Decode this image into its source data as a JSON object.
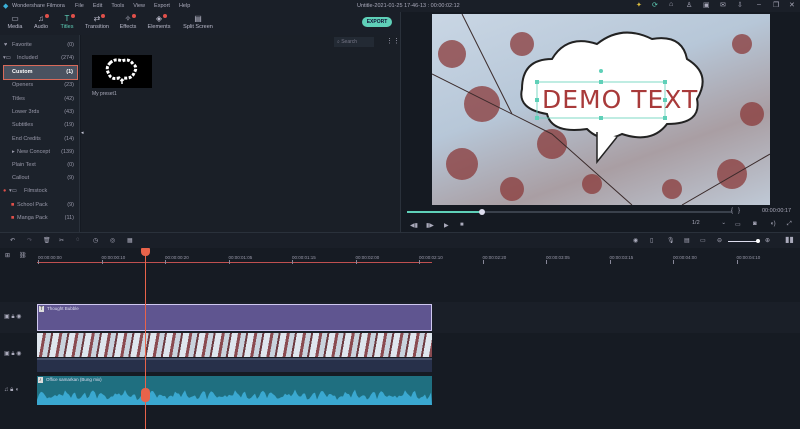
{
  "app": {
    "name": "Wondershare Filmora",
    "title": "Untitle-2021-01-25 17-46-13 : 00:00:02:12",
    "menu": [
      "File",
      "Edit",
      "Tools",
      "View",
      "Export",
      "Help"
    ]
  },
  "toolbar": {
    "tabs": [
      {
        "label": "Media"
      },
      {
        "label": "Audio"
      },
      {
        "label": "Titles"
      },
      {
        "label": "Transition"
      },
      {
        "label": "Effects"
      },
      {
        "label": "Elements"
      },
      {
        "label": "Split Screen"
      }
    ],
    "export_label": "EXPORT"
  },
  "sidebar": {
    "items": [
      {
        "label": "Favorite",
        "count": "(0)"
      },
      {
        "label": "Included",
        "count": "(274)"
      },
      {
        "label": "Custom",
        "count": "(1)"
      },
      {
        "label": "Openers",
        "count": "(23)"
      },
      {
        "label": "Titles",
        "count": "(42)"
      },
      {
        "label": "Lower 3rds",
        "count": "(43)"
      },
      {
        "label": "Subtitles",
        "count": "(19)"
      },
      {
        "label": "End Credits",
        "count": "(14)"
      },
      {
        "label": "New Concept",
        "count": "(139)"
      },
      {
        "label": "Plain Text",
        "count": "(0)"
      },
      {
        "label": "Callout",
        "count": "(9)"
      },
      {
        "label": "Filmstock",
        "count": ""
      },
      {
        "label": "School Pack",
        "count": "(9)"
      },
      {
        "label": "Manga Pack",
        "count": "(11)"
      }
    ]
  },
  "library": {
    "search_placeholder": "Search",
    "items": [
      {
        "label": "My preset1"
      }
    ]
  },
  "preview": {
    "overlay_text": "DEMO TEXT",
    "timecode": "00:00:00:17",
    "quality": "1/2",
    "progress": 0.23
  },
  "timeline": {
    "ruler": [
      "00:00:00:00",
      "00:00:00:10",
      "00:00:00:20",
      "00:00:01:05",
      "00:00:01:15",
      "00:00:02:00",
      "00:00:02:10",
      "00:00:02:20",
      "00:00:03:05",
      "00:00:03:15",
      "00:00:04:00",
      "00:00:04:10"
    ],
    "clips": {
      "title": "Thought Bubble",
      "audio": "Office samarkan (Bung mix)"
    }
  },
  "colors": {
    "accent": "#5fd0b8",
    "playhead": "#e8634a",
    "title_clip": "#5f5590",
    "audio_clip": "#1f6f80"
  }
}
